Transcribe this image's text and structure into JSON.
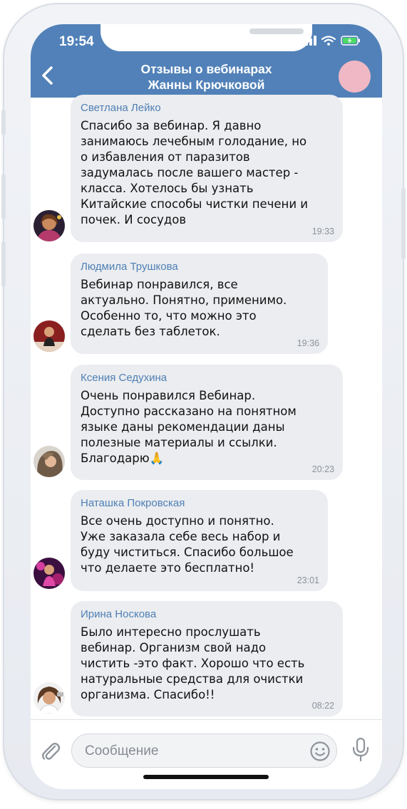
{
  "status_bar": {
    "time": "19:54"
  },
  "header": {
    "title_line1": "Отзывы о вебинарах",
    "title_line2": "Жанны Крючковой"
  },
  "input": {
    "placeholder": "Сообщение"
  },
  "messages": [
    {
      "sender": "Светлана Лейко",
      "lines": [
        "Спасибо за вебинар. Я давно",
        "занимаюсь лечебным голодание, но",
        "о избавления от паразитов",
        "задумалась после вашего мастер -",
        "класса. Хотелось бы узнать",
        "Китайские способы чистки печени и",
        "почек. И сосудов"
      ],
      "time": "19:33"
    },
    {
      "sender": "Людмила Трушкова",
      "lines": [
        "Вебинар понравился, все",
        "актуально. Понятно, применимо.",
        "Особенно то, что можно это",
        "сделать без таблеток."
      ],
      "time": "19:36"
    },
    {
      "sender": "Ксения Седухина",
      "lines": [
        "Очень понравился Вебинар.",
        "Доступно рассказано на понятном",
        "языке даны рекомендации даны",
        "полезные материалы и ссылки.",
        "Благодарю🙏"
      ],
      "time": "20:23"
    },
    {
      "sender": "Наташка Покровская",
      "lines": [
        "Все очень доступно и понятно.",
        "Уже заказала себе весь набор и",
        "буду чиститься. Спасибо большое",
        "что делаете это бесплатно!"
      ],
      "time": "23:01"
    },
    {
      "sender": "Ирина Носкова",
      "lines": [
        "Было интересно прослушать",
        "вебинар. Организм свой надо",
        "чистить -это факт. Хорошо что есть",
        "натуральные средства для очистки",
        "организма. Спасибо!!"
      ],
      "time": "08:22"
    }
  ],
  "colors": {
    "header": "#5181b8",
    "bubble": "#ebedf0",
    "sender": "#4f7fb4",
    "header_avatar": "#f0b8c4"
  }
}
